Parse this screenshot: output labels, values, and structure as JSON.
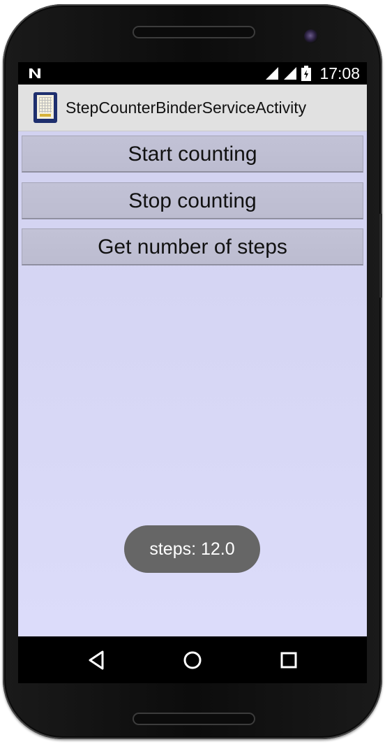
{
  "status_bar": {
    "time": "17:08",
    "icons": [
      "n-notification-icon",
      "signal-icon",
      "signal-icon",
      "battery-charging-icon"
    ]
  },
  "action_bar": {
    "title": "StepCounterBinderServiceActivity",
    "icon": "app-launcher-icon"
  },
  "buttons": {
    "start_label": "Start counting",
    "stop_label": "Stop counting",
    "get_steps_label": "Get number of steps"
  },
  "toast": {
    "message": "steps: 12.0"
  },
  "nav_bar": {
    "icons": [
      "back-icon",
      "home-icon",
      "recents-icon"
    ]
  },
  "colors": {
    "content_background": "#d8d8f6",
    "button_background": "#bfbfd3",
    "action_bar_background": "#e1e1e1",
    "toast_background": "#666666"
  }
}
